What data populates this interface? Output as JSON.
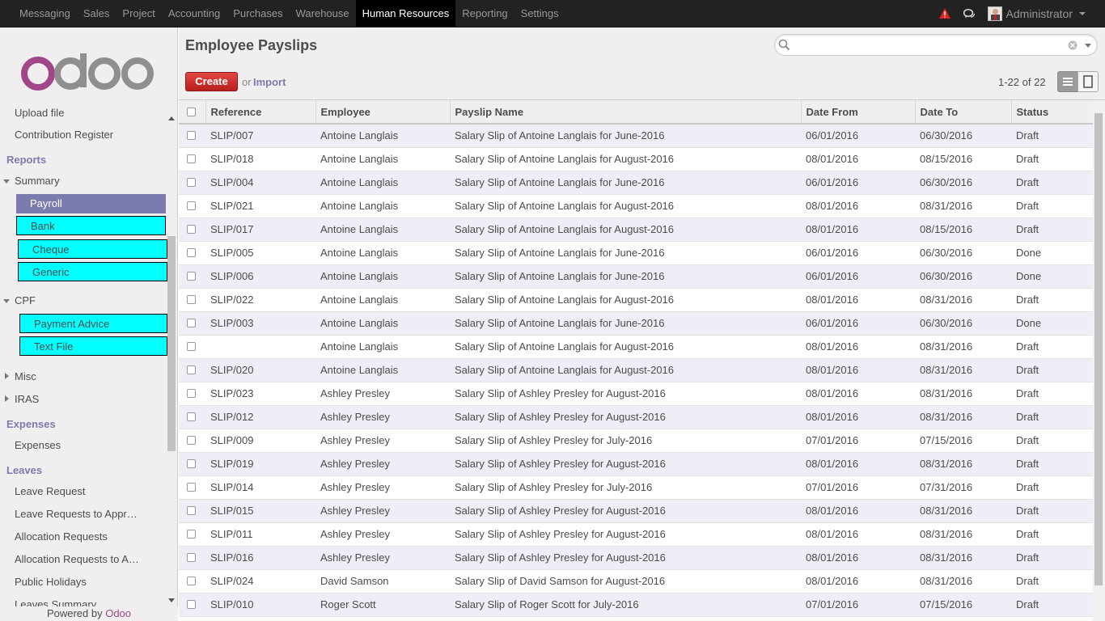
{
  "topbar": {
    "menu": [
      {
        "label": "Messaging",
        "active": false
      },
      {
        "label": "Sales",
        "active": false
      },
      {
        "label": "Project",
        "active": false
      },
      {
        "label": "Accounting",
        "active": false
      },
      {
        "label": "Purchases",
        "active": false
      },
      {
        "label": "Warehouse",
        "active": false
      },
      {
        "label": "Human Resources",
        "active": true
      },
      {
        "label": "Reporting",
        "active": false
      },
      {
        "label": "Settings",
        "active": false
      }
    ],
    "user": "Administrator",
    "icons": {
      "alert": "warning-icon",
      "chat": "chat-bubbles-icon"
    },
    "alert_color": "#e5201e"
  },
  "sidebar": {
    "logo_text": "odoo",
    "partial_top": "Upload file",
    "contribution": "Contribution Register",
    "reports_head": "Reports",
    "summary": "Summary",
    "summary_items": [
      "Payroll",
      "Bank",
      "Cheque",
      "Generic"
    ],
    "cpf": "CPF",
    "cpf_items": [
      "Payment Advice",
      "Text File"
    ],
    "misc": "Misc",
    "iras": "IRAS",
    "expenses_head": "Expenses",
    "expenses": "Expenses",
    "leaves_head": "Leaves",
    "leaves_items": [
      "Leave Request",
      "Leave Requests to Appr…",
      "Allocation Requests",
      "Allocation Requests to A…",
      "Public Holidays",
      "Leaves Summary"
    ],
    "powered_prefix": "Powered by ",
    "powered_brand": "Odoo",
    "accent": "#7c7bad",
    "highlight": "#00ffff"
  },
  "header": {
    "title": "Employee Payslips",
    "search_placeholder": "",
    "create_label": "Create",
    "or_label": "or",
    "import_label": "Import",
    "pager": "1-22 of 22"
  },
  "table": {
    "columns": [
      "Reference",
      "Employee",
      "Payslip Name",
      "Date From",
      "Date To",
      "Status"
    ],
    "rows": [
      [
        "SLIP/007",
        "Antoine Langlais",
        "Salary Slip of Antoine Langlais for June-2016",
        "06/01/2016",
        "06/30/2016",
        "Draft"
      ],
      [
        "SLIP/018",
        "Antoine Langlais",
        "Salary Slip of Antoine Langlais for August-2016",
        "08/01/2016",
        "08/15/2016",
        "Draft"
      ],
      [
        "SLIP/004",
        "Antoine Langlais",
        "Salary Slip of Antoine Langlais for June-2016",
        "06/01/2016",
        "06/30/2016",
        "Draft"
      ],
      [
        "SLIP/021",
        "Antoine Langlais",
        "Salary Slip of Antoine Langlais for August-2016",
        "08/01/2016",
        "08/31/2016",
        "Draft"
      ],
      [
        "SLIP/017",
        "Antoine Langlais",
        "Salary Slip of Antoine Langlais for August-2016",
        "08/01/2016",
        "08/15/2016",
        "Draft"
      ],
      [
        "SLIP/005",
        "Antoine Langlais",
        "Salary Slip of Antoine Langlais for June-2016",
        "06/01/2016",
        "06/30/2016",
        "Done"
      ],
      [
        "SLIP/006",
        "Antoine Langlais",
        "Salary Slip of Antoine Langlais for June-2016",
        "06/01/2016",
        "06/30/2016",
        "Done"
      ],
      [
        "SLIP/022",
        "Antoine Langlais",
        "Salary Slip of Antoine Langlais for August-2016",
        "08/01/2016",
        "08/31/2016",
        "Draft"
      ],
      [
        "SLIP/003",
        "Antoine Langlais",
        "Salary Slip of Antoine Langlais for June-2016",
        "06/01/2016",
        "06/30/2016",
        "Done"
      ],
      [
        "",
        "Antoine Langlais",
        "Salary Slip of Antoine Langlais for August-2016",
        "08/01/2016",
        "08/31/2016",
        "Draft"
      ],
      [
        "SLIP/020",
        "Antoine Langlais",
        "Salary Slip of Antoine Langlais for August-2016",
        "08/01/2016",
        "08/31/2016",
        "Draft"
      ],
      [
        "SLIP/023",
        "Ashley Presley",
        "Salary Slip of Ashley Presley for August-2016",
        "08/01/2016",
        "08/31/2016",
        "Draft"
      ],
      [
        "SLIP/012",
        "Ashley Presley",
        "Salary Slip of Ashley Presley for August-2016",
        "08/01/2016",
        "08/31/2016",
        "Draft"
      ],
      [
        "SLIP/009",
        "Ashley Presley",
        "Salary Slip of Ashley Presley for July-2016",
        "07/01/2016",
        "07/15/2016",
        "Draft"
      ],
      [
        "SLIP/019",
        "Ashley Presley",
        "Salary Slip of Ashley Presley for August-2016",
        "08/01/2016",
        "08/31/2016",
        "Draft"
      ],
      [
        "SLIP/014",
        "Ashley Presley",
        "Salary Slip of Ashley Presley for July-2016",
        "07/01/2016",
        "07/31/2016",
        "Draft"
      ],
      [
        "SLIP/015",
        "Ashley Presley",
        "Salary Slip of Ashley Presley for August-2016",
        "08/01/2016",
        "08/31/2016",
        "Draft"
      ],
      [
        "SLIP/011",
        "Ashley Presley",
        "Salary Slip of Ashley Presley for August-2016",
        "08/01/2016",
        "08/31/2016",
        "Draft"
      ],
      [
        "SLIP/016",
        "Ashley Presley",
        "Salary Slip of Ashley Presley for August-2016",
        "08/01/2016",
        "08/31/2016",
        "Draft"
      ],
      [
        "SLIP/024",
        "David Samson",
        "Salary Slip of David Samson for August-2016",
        "08/01/2016",
        "08/31/2016",
        "Draft"
      ],
      [
        "SLIP/010",
        "Roger Scott",
        "Salary Slip of Roger Scott for July-2016",
        "07/01/2016",
        "07/15/2016",
        "Draft"
      ]
    ]
  }
}
